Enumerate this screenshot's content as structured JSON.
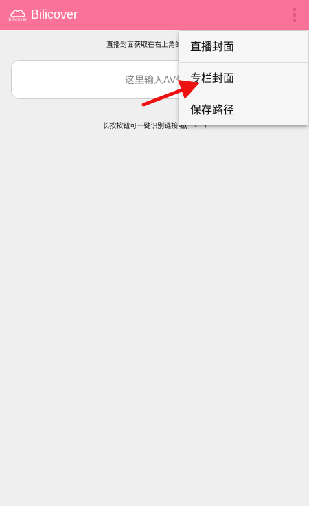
{
  "app_bar": {
    "title": "Bilicover",
    "logo_text": "bilicover",
    "accent_color": "#fb7299",
    "overflow_icon": "more-vert-icon"
  },
  "main": {
    "hint_top": "直播封面获取在右上角的功能中",
    "input_placeholder": "这里输入AV号",
    "hint_bottom": "长按按钮可一键识别链接哦(゜-゜)"
  },
  "menu": {
    "items": [
      {
        "label": "直播封面"
      },
      {
        "label": "专栏封面"
      },
      {
        "label": "保存路径"
      }
    ]
  },
  "annotation": {
    "arrow_color": "#ee1111"
  }
}
